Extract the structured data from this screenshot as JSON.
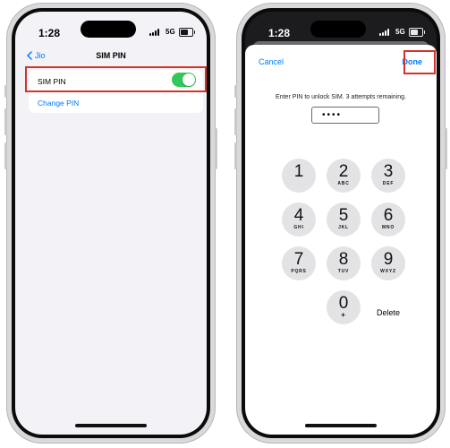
{
  "left_phone": {
    "status": {
      "time": "1:28",
      "network": "5G"
    },
    "nav": {
      "back_label": "Jio",
      "title": "SIM PIN"
    },
    "rows": [
      {
        "label": "SIM PIN",
        "toggle_on": true
      },
      {
        "label": "Change PIN"
      }
    ]
  },
  "right_phone": {
    "status": {
      "time": "1:28",
      "network": "5G"
    },
    "nav": {
      "cancel_label": "Cancel",
      "done_label": "Done"
    },
    "message": "Enter PIN to unlock SIM. 3 attempts remaining.",
    "pin_value": "••••",
    "keys": [
      {
        "digit": "1",
        "letters": ""
      },
      {
        "digit": "2",
        "letters": "ABC"
      },
      {
        "digit": "3",
        "letters": "DEF"
      },
      {
        "digit": "4",
        "letters": "GHI"
      },
      {
        "digit": "5",
        "letters": "JKL"
      },
      {
        "digit": "6",
        "letters": "MNO"
      },
      {
        "digit": "7",
        "letters": "PQRS"
      },
      {
        "digit": "8",
        "letters": "TUV"
      },
      {
        "digit": "9",
        "letters": "WXYZ"
      },
      {
        "digit": "0",
        "letters": "+"
      }
    ],
    "delete_label": "Delete"
  },
  "colors": {
    "accent": "#007aff",
    "toggle_on": "#34c759",
    "highlight": "#d2342b"
  }
}
